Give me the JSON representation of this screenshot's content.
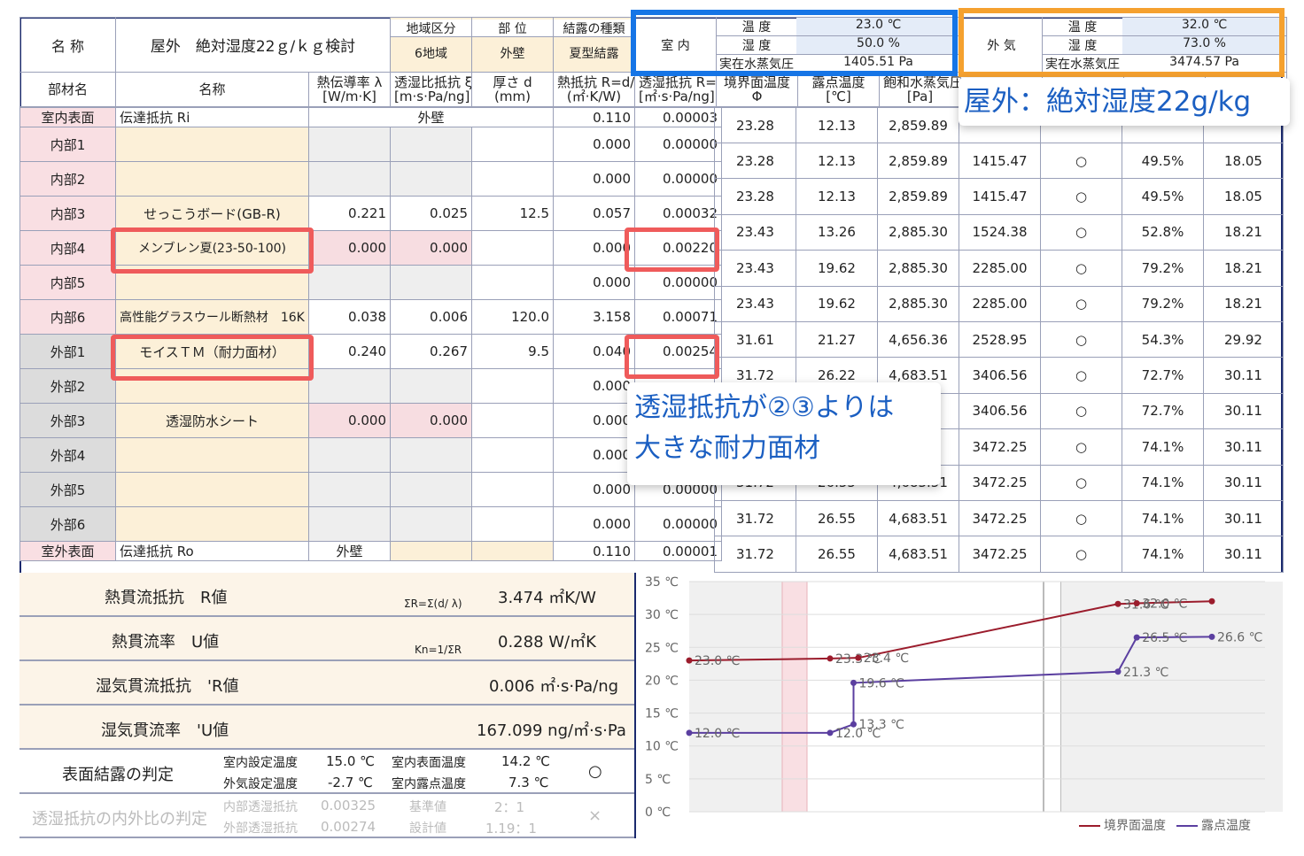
{
  "header": {
    "name_label": "名 称",
    "title": "屋外　絶対湿度22ｇ/ｋｇ検討",
    "region_label": "地域区分",
    "region": "6地域",
    "part_label": "部 位",
    "part": "外壁",
    "cond_label": "結露の種類",
    "cond": "夏型結露",
    "indoor_label": "室 内",
    "outdoor_label": "外 気",
    "temp_label": "温 度",
    "hum_label": "湿 度",
    "vp_label": "実在水蒸気圧",
    "in_temp": "23.0 ℃",
    "in_hum": "50.0 %",
    "in_vp": "1405.51 Pa",
    "out_temp": "32.0 ℃",
    "out_hum": "73.0 %",
    "out_vp": "3474.57 Pa"
  },
  "columns": {
    "part": "部材名",
    "name": "名称",
    "lambda": [
      "熱伝導率 λ",
      "[W/m·K]"
    ],
    "xi": [
      "透湿比抵抗 ξ",
      "[m·s·Pa/ng]"
    ],
    "thick": [
      "厚さ d",
      "(mm)"
    ],
    "R": [
      "熱抵抗 R=d/ λ",
      "(㎡·K/W)"
    ],
    "Rv": [
      "透湿抵抗 R=d×ξ",
      "[㎡·s·Pa/ng]"
    ],
    "t": [
      "境界面温度",
      "Φ"
    ],
    "dew": [
      "露点温度",
      "[℃]"
    ],
    "psat": [
      "飽和水蒸気圧",
      "[Pa]"
    ]
  },
  "inner_surface": {
    "label": "室内表面",
    "name": "伝達抵抗 Ri",
    "mid": "外壁",
    "R": "0.110",
    "Rv": "0.00003"
  },
  "outer_surface": {
    "label": "室外表面",
    "name": "伝達抵抗 Ro",
    "mid": "外壁",
    "R": "0.110",
    "Rv": "0.00001"
  },
  "rows": [
    {
      "part": "内部1",
      "name": "",
      "lambda": "",
      "xi": "",
      "d": "",
      "R": "0.000",
      "Rv": "0.00000"
    },
    {
      "part": "内部2",
      "name": "",
      "lambda": "",
      "xi": "",
      "d": "",
      "R": "0.000",
      "Rv": "0.00000"
    },
    {
      "part": "内部3",
      "name": "せっこうボード(GB-R)",
      "lambda": "0.221",
      "xi": "0.025",
      "d": "12.5",
      "R": "0.057",
      "Rv": "0.00032"
    },
    {
      "part": "内部4",
      "name": "メンブレン夏(23-50-100)",
      "lambda": "0.000",
      "xi": "0.000",
      "d": "",
      "R": "0.000",
      "Rv": "0.00220"
    },
    {
      "part": "内部5",
      "name": "",
      "lambda": "",
      "xi": "",
      "d": "",
      "R": "0.000",
      "Rv": "0.00000"
    },
    {
      "part": "内部6",
      "name": "高性能グラスウール断熱材　16K",
      "lambda": "0.038",
      "xi": "0.006",
      "d": "120.0",
      "R": "3.158",
      "Rv": "0.00071"
    },
    {
      "part": "外部1",
      "name": "モイスＴＭ（耐力面材）",
      "lambda": "0.240",
      "xi": "0.267",
      "d": "9.5",
      "R": "0.040",
      "Rv": "0.00254"
    },
    {
      "part": "外部2",
      "name": "",
      "lambda": "",
      "xi": "",
      "d": "",
      "R": "0.000",
      "Rv": ""
    },
    {
      "part": "外部3",
      "name": "透湿防水シート",
      "lambda": "0.000",
      "xi": "0.000",
      "d": "",
      "R": "0.000",
      "Rv": ""
    },
    {
      "part": "外部4",
      "name": "",
      "lambda": "",
      "xi": "",
      "d": "",
      "R": "0.000",
      "Rv": ""
    },
    {
      "part": "外部5",
      "name": "",
      "lambda": "",
      "xi": "",
      "d": "",
      "R": "0.000",
      "Rv": "0.00000"
    },
    {
      "part": "外部6",
      "name": "",
      "lambda": "",
      "xi": "",
      "d": "",
      "R": "0.000",
      "Rv": "0.00000"
    }
  ],
  "right_rows": [
    {
      "t": "23.28",
      "dew": "12.13",
      "ps": "2,859.89",
      "p": "",
      "j": "",
      "rh": "",
      "x": ""
    },
    {
      "t": "23.28",
      "dew": "12.13",
      "ps": "2,859.89",
      "p": "1415.47",
      "j": "○",
      "rh": "49.5%",
      "x": "18.05"
    },
    {
      "t": "23.28",
      "dew": "12.13",
      "ps": "2,859.89",
      "p": "1415.47",
      "j": "○",
      "rh": "49.5%",
      "x": "18.05"
    },
    {
      "t": "23.43",
      "dew": "13.26",
      "ps": "2,885.30",
      "p": "1524.38",
      "j": "○",
      "rh": "52.8%",
      "x": "18.21"
    },
    {
      "t": "23.43",
      "dew": "19.62",
      "ps": "2,885.30",
      "p": "2285.00",
      "j": "○",
      "rh": "79.2%",
      "x": "18.21"
    },
    {
      "t": "23.43",
      "dew": "19.62",
      "ps": "2,885.30",
      "p": "2285.00",
      "j": "○",
      "rh": "79.2%",
      "x": "18.21"
    },
    {
      "t": "31.61",
      "dew": "21.27",
      "ps": "4,656.36",
      "p": "2528.95",
      "j": "○",
      "rh": "54.3%",
      "x": "29.92"
    },
    {
      "t": "31.72",
      "dew": "26.22",
      "ps": "4,683.51",
      "p": "3406.56",
      "j": "○",
      "rh": "72.7%",
      "x": "30.11"
    },
    {
      "t": "",
      "dew": "",
      "ps": "1",
      "p": "3406.56",
      "j": "○",
      "rh": "72.7%",
      "x": "30.11"
    },
    {
      "t": "",
      "dew": "",
      "ps": "1",
      "p": "3472.25",
      "j": "○",
      "rh": "74.1%",
      "x": "30.11"
    },
    {
      "t": "31.72",
      "dew": "26.55",
      "ps": "4,683.51",
      "p": "3472.25",
      "j": "○",
      "rh": "74.1%",
      "x": "30.11"
    },
    {
      "t": "31.72",
      "dew": "26.55",
      "ps": "4,683.51",
      "p": "3472.25",
      "j": "○",
      "rh": "74.1%",
      "x": "30.11"
    },
    {
      "t": "31.72",
      "dew": "26.55",
      "ps": "4,683.51",
      "p": "3472.25",
      "j": "○",
      "rh": "74.1%",
      "x": "30.11"
    }
  ],
  "summary": {
    "r_label": "熱貫流抵抗　R値",
    "r_formula": "ΣR=Σ(d/ λ)",
    "r_value": "3.474 ㎡K/W",
    "u_label": "熱貫流率　U値",
    "u_formula": "Kn=1/ΣR",
    "u_value": "0.288 W/㎡K",
    "rv_label": "湿気貫流抵抗　'R値",
    "rv_value": "0.006 ㎡·s·Pa/ng",
    "uv_label": "湿気貫流率　'U値",
    "uv_value": "167.099 ng/㎡·s·Pa",
    "cond_label": "表面結露の判定",
    "in_set": "室内設定温度",
    "in_set_v": "15.0 ℃",
    "out_set": "外気設定温度",
    "out_set_v": "-2.7 ℃",
    "in_surf": "室内表面温度",
    "in_surf_v": "14.2 ℃",
    "in_dew": "室内露点温度",
    "in_dew_v": "7.3 ℃",
    "cond_result": "○",
    "ratio_label": "透湿抵抗の内外比の判定",
    "inner_rv": "内部透湿抵抗",
    "inner_rv_v": "0.00325",
    "outer_rv": "外部透湿抵抗",
    "outer_rv_v": "0.00274",
    "std": "基準値",
    "std_v": "2：1",
    "design": "設計値",
    "design_v": "1.19：1",
    "ratio_result": "×"
  },
  "callouts": {
    "outdoor": "屋外：絶対湿度22g/kg",
    "board": [
      "透湿抵抗が②③よりは",
      "大きな耐力面材"
    ]
  },
  "colors": {
    "highlight_red": "#ef5b5b",
    "highlight_blue": "#1675e6",
    "highlight_orange": "#f5a12f",
    "series_temp": "#9b1c2c",
    "series_dew": "#5b3fa0"
  },
  "chart_data": {
    "type": "line",
    "ylim": [
      0,
      35
    ],
    "yticks": [
      "0 ℃",
      "5 ℃",
      "10 ℃",
      "15 ℃",
      "20 ℃",
      "25 ℃",
      "30 ℃",
      "35 ℃"
    ],
    "legend": [
      "境界面温度",
      "露点温度"
    ],
    "series": [
      {
        "name": "境界面温度",
        "color": "#9b1c2c",
        "points": [
          [
            0,
            23.0
          ],
          [
            0.3,
            23.3
          ],
          [
            0.36,
            23.4
          ],
          [
            0.8,
            31.6
          ],
          [
            0.84,
            31.7
          ],
          [
            1.0,
            32.0
          ]
        ],
        "labels": [
          "23.0 ℃",
          "23.3 ℃",
          "23.4 ℃",
          "31.6 ℃",
          "32.0 ℃"
        ]
      },
      {
        "name": "露点温度",
        "color": "#5b3fa0",
        "points": [
          [
            0,
            12.0
          ],
          [
            0.3,
            12.0
          ],
          [
            0.35,
            13.3
          ],
          [
            0.35,
            19.6
          ],
          [
            0.8,
            21.3
          ],
          [
            0.84,
            26.5
          ],
          [
            1.0,
            26.6
          ]
        ],
        "labels": [
          "12.0 ℃",
          "12.0 ℃",
          "13.3 ℃",
          "19.6 ℃",
          "21.3 ℃",
          "26.5 ℃",
          "26.6 ℃"
        ]
      }
    ]
  }
}
